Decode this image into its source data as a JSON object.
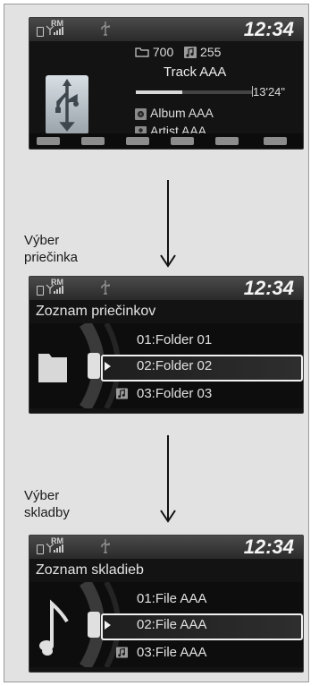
{
  "screen_top": {
    "rm_label": "RM",
    "clock": "12:34",
    "folder_count": "700",
    "track_count": "255",
    "track_title": "Track AAA",
    "elapsed_time": "13'24\"",
    "progress_fraction": 0.4,
    "album": "Album AAA",
    "artist": "Artist AAA",
    "softkey_icons": [
      "folder-play-icon",
      "folder-scan-icon",
      "repeat-icon",
      "repeat-folder-icon",
      "random-icon",
      "random-folder-icon"
    ]
  },
  "step1": {
    "label_line1": "Výber",
    "label_line2": "priečinka"
  },
  "screen_folders": {
    "rm_label": "RM",
    "clock": "12:34",
    "title": "Zoznam priečinkov",
    "items": [
      "01:Folder 01",
      "02:Folder 02",
      "03:Folder 03"
    ],
    "selected_index": 1
  },
  "step2": {
    "label_line1": "Výber",
    "label_line2": "skladby"
  },
  "screen_files": {
    "rm_label": "RM",
    "clock": "12:34",
    "title": "Zoznam skladieb",
    "items": [
      "01:File AAA",
      "02:File AAA",
      "03:File AAA"
    ],
    "selected_index": 1
  },
  "colors": {
    "screen_bg": "#131313",
    "page_bg": "#e2e2e2",
    "highlight": "#f0f0f0"
  }
}
